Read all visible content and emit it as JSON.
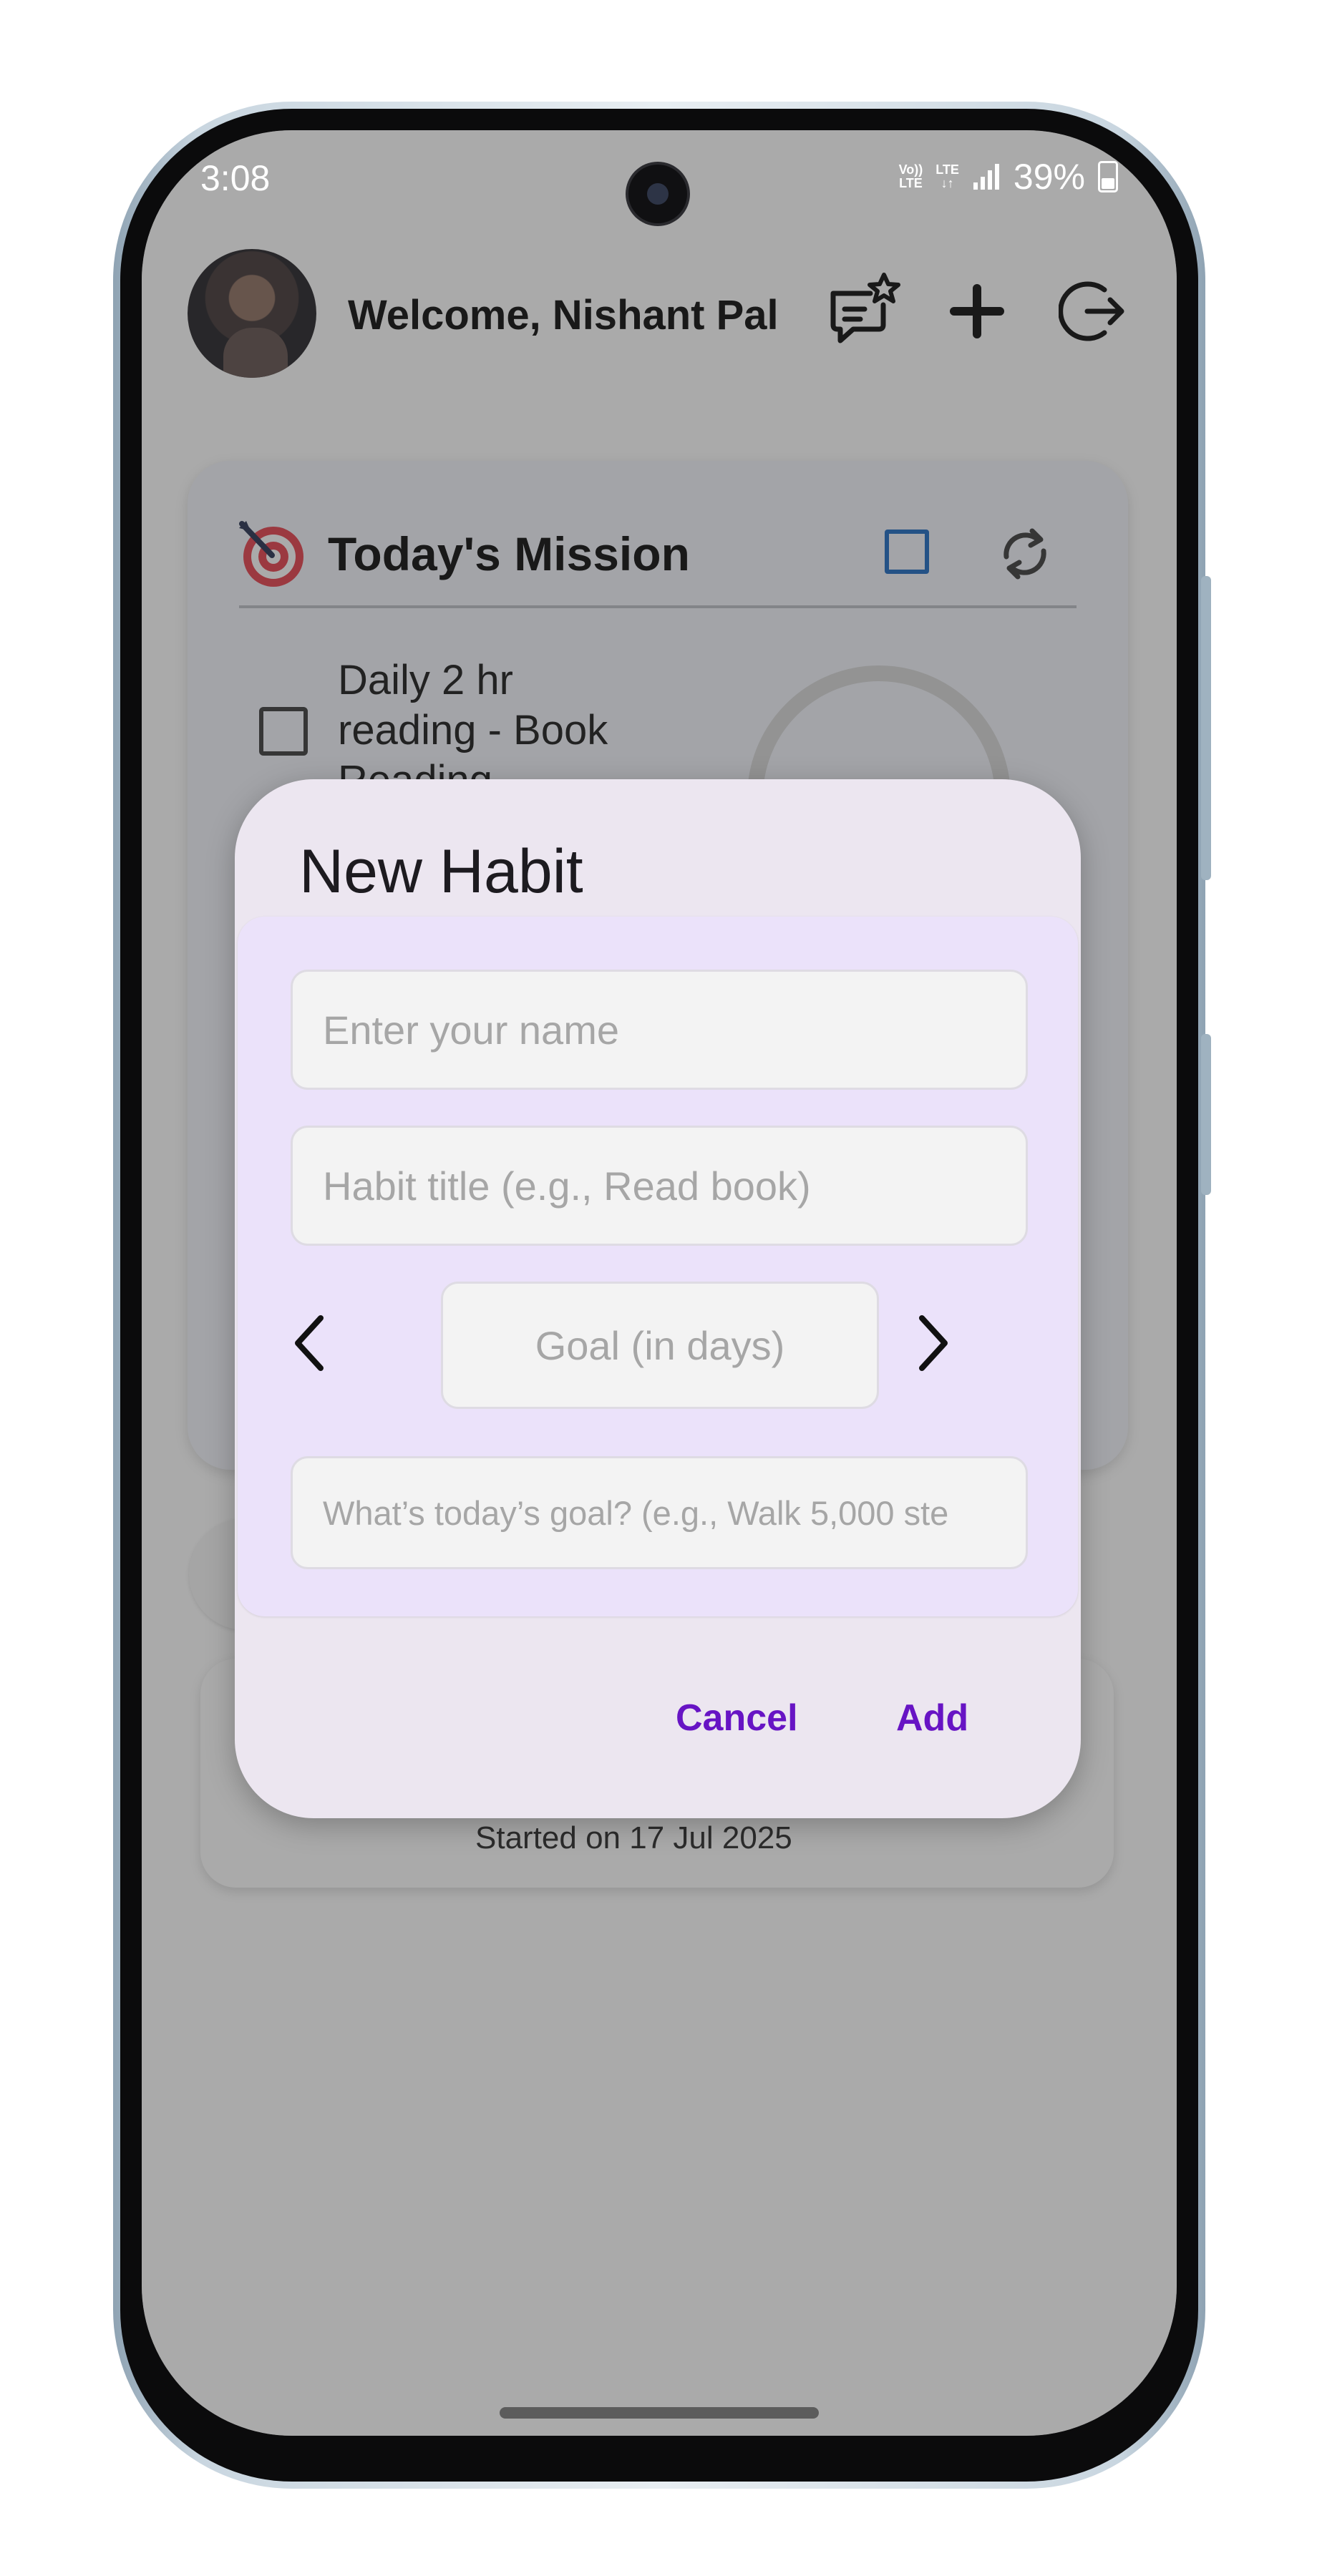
{
  "status_bar": {
    "time": "3:08",
    "volte_top": "Vo))",
    "volte_bottom": "LTE",
    "lte_label": "LTE",
    "lte_arrows": "↓↑",
    "battery_text": "39%"
  },
  "header": {
    "welcome_text": "Welcome, Nishant Pal",
    "icons": [
      "feedback-star-icon",
      "plus-icon",
      "logout-icon"
    ]
  },
  "mission": {
    "title": "Today's Mission",
    "tasks": [
      {
        "label": "Daily 2 hr reading - Book Reading"
      }
    ]
  },
  "habit_card": {
    "started_text": "Started on 17 Jul 2025"
  },
  "dialog": {
    "title": "New Habit",
    "name_placeholder": "Enter your name",
    "habit_title_placeholder": "Habit title (e.g., Read book)",
    "goal_placeholder": "Goal (in days)",
    "today_goal_placeholder": "What’s today’s goal? (e.g., Walk 5,000 ste",
    "cancel_label": "Cancel",
    "add_label": "Add"
  },
  "colors": {
    "accent": "#6714c4",
    "checkbox_blue": "#1565c0",
    "dialog_bg": "#ece6f0",
    "dialog_body_bg": "#ebe2fa",
    "scrim": "#3a3a3a"
  }
}
